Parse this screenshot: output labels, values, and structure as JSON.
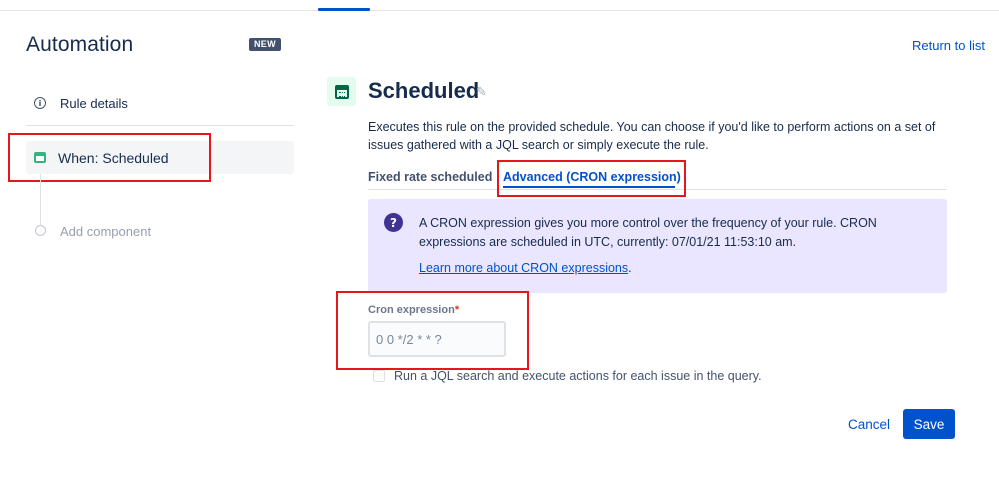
{
  "sidebar": {
    "title": "Automation",
    "badge": "NEW",
    "items": [
      {
        "label": "Rule details",
        "icon": "info-icon"
      },
      {
        "label": "When: Scheduled",
        "icon": "calendar-icon"
      },
      {
        "label": "Add component",
        "icon": "timeline-dot"
      }
    ]
  },
  "header": {
    "return_link": "Return to list"
  },
  "trigger": {
    "icon": "calendar-icon",
    "title": "Scheduled",
    "edit_icon": "pencil-icon",
    "description": "Executes this rule on the provided schedule. You can choose if you'd like to perform actions on a set of issues gathered with a JQL search or simply execute the rule."
  },
  "tabs": [
    {
      "label": "Fixed rate scheduled",
      "selected": false
    },
    {
      "label": "Advanced (CRON expression)",
      "selected": true
    }
  ],
  "info_panel": {
    "icon": "question-icon",
    "text": "A CRON expression gives you more control over the frequency of your rule. CRON expressions are scheduled in UTC, currently: 07/01/21 11:53:10 am.",
    "link_text": "Learn more about CRON expressions",
    "link_suffix": "."
  },
  "form": {
    "cron_label": "Cron expression",
    "required_marker": "*",
    "cron_value": "",
    "cron_placeholder": "0 0 */2 * * ?",
    "jql_checkbox_label": "Run a JQL search and execute actions for each issue in the query.",
    "jql_checked": false
  },
  "actions": {
    "cancel_label": "Cancel",
    "save_label": "Save"
  },
  "colors": {
    "primary": "#0052cc",
    "annotation_red": "#e5161c",
    "info_panel_bg": "#eae6ff",
    "trigger_icon_green": "#36b37e",
    "badge_bg": "#42526e"
  }
}
